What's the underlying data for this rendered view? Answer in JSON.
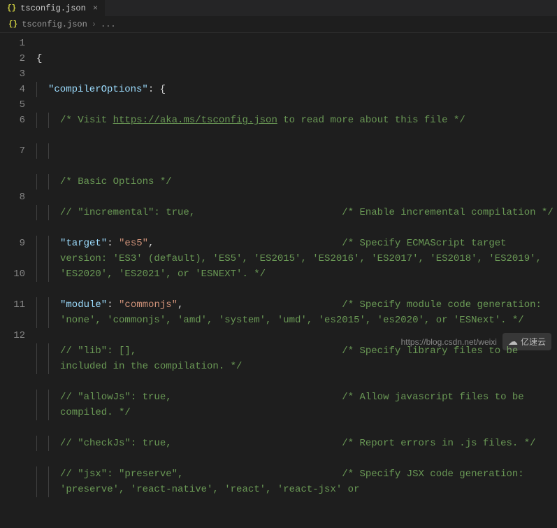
{
  "tab": {
    "filename": "tsconfig.json",
    "close_symbol": "×"
  },
  "breadcrumb": {
    "filename": "tsconfig.json",
    "rest": "..."
  },
  "gutter": [
    "1",
    "2",
    "3",
    "4",
    "5",
    "6",
    "7",
    "8",
    "9",
    "10",
    "11",
    "12"
  ],
  "code": {
    "l1_brace": "{",
    "l2_key": "\"compilerOptions\"",
    "l2_after": ": {",
    "l3_a": "/* Visit ",
    "l3_link": "https://aka.ms/tsconfig.json",
    "l3_b": " to read more about this file */",
    "l5": "/* Basic Options */",
    "l6": "// \"incremental\": true,                         /* Enable incremental compilation */",
    "l7_key": "\"target\"",
    "l7_colon": ": ",
    "l7_val": "\"es5\"",
    "l7_comma": ",",
    "l7_com": "                                /* Specify ECMAScript target version: 'ES3' (default), 'ES5', 'ES2015', 'ES2016', 'ES2017', 'ES2018', 'ES2019', 'ES2020', 'ES2021', or 'ESNEXT'. */",
    "l8_key": "\"module\"",
    "l8_colon": ": ",
    "l8_val": "\"commonjs\"",
    "l8_comma": ",",
    "l8_com": "                           /* Specify module code generation: 'none', 'commonjs', 'amd', 'system', 'umd', 'es2015', 'es2020', or 'ESNext'. */",
    "l9": "// \"lib\": [],                                   /* Specify library files to be included in the compilation. */",
    "l10": "// \"allowJs\": true,                             /* Allow javascript files to be compiled. */",
    "l11": "// \"checkJs\": true,                             /* Report errors in .js files. */",
    "l12": "// \"jsx\": \"preserve\",                           /* Specify JSX code generation: 'preserve', 'react-native', 'react', 'react-jsx' or"
  },
  "watermark": {
    "url": "https://blog.csdn.net/weixi",
    "brand": "亿速云"
  }
}
